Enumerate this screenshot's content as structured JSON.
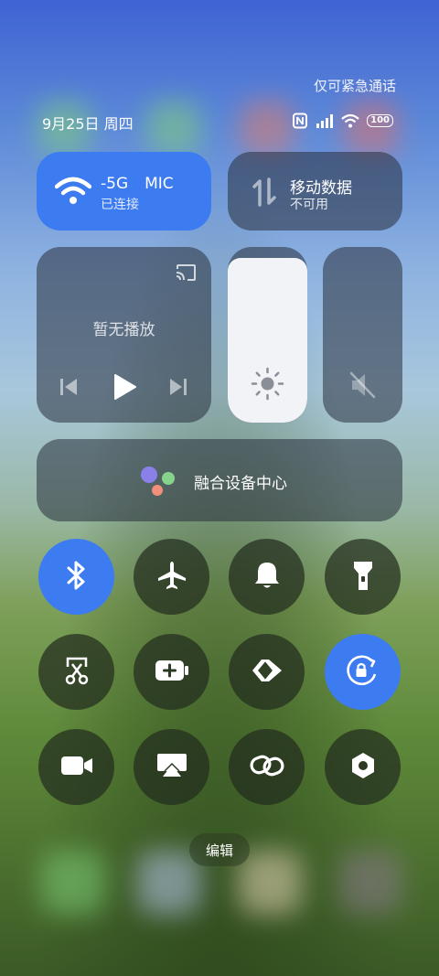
{
  "status": {
    "emergency_text": "仅可紧急通话",
    "date_text": "9月25日 周四",
    "battery_level": "100"
  },
  "wifi": {
    "name": "-5G",
    "name_suffix": "MIC",
    "status": "已连接",
    "active": true
  },
  "mobile_data": {
    "title": "移动数据",
    "status": "不可用"
  },
  "media": {
    "status": "暂无播放"
  },
  "brightness": {
    "level": 0.94
  },
  "volume": {
    "muted": true
  },
  "device_center": {
    "label": "融合设备中心"
  },
  "toggles": [
    {
      "icon": "bluetooth-icon",
      "active": true
    },
    {
      "icon": "airplane-icon",
      "active": false
    },
    {
      "icon": "bell-icon",
      "active": false
    },
    {
      "icon": "flashlight-icon",
      "active": false
    },
    {
      "icon": "screenshot-icon",
      "active": false
    },
    {
      "icon": "battery-saver-icon",
      "active": false
    },
    {
      "icon": "nearby-share-icon",
      "active": false
    },
    {
      "icon": "rotation-lock-icon",
      "active": true
    },
    {
      "icon": "video-camera-icon",
      "active": false
    },
    {
      "icon": "screen-cast-icon",
      "active": false
    },
    {
      "icon": "link-icon",
      "active": false
    },
    {
      "icon": "settings-hex-icon",
      "active": false
    }
  ],
  "edit": {
    "label": "编辑"
  },
  "colors": {
    "accent": "#3d7bf0",
    "tile_dark": "#283039"
  }
}
